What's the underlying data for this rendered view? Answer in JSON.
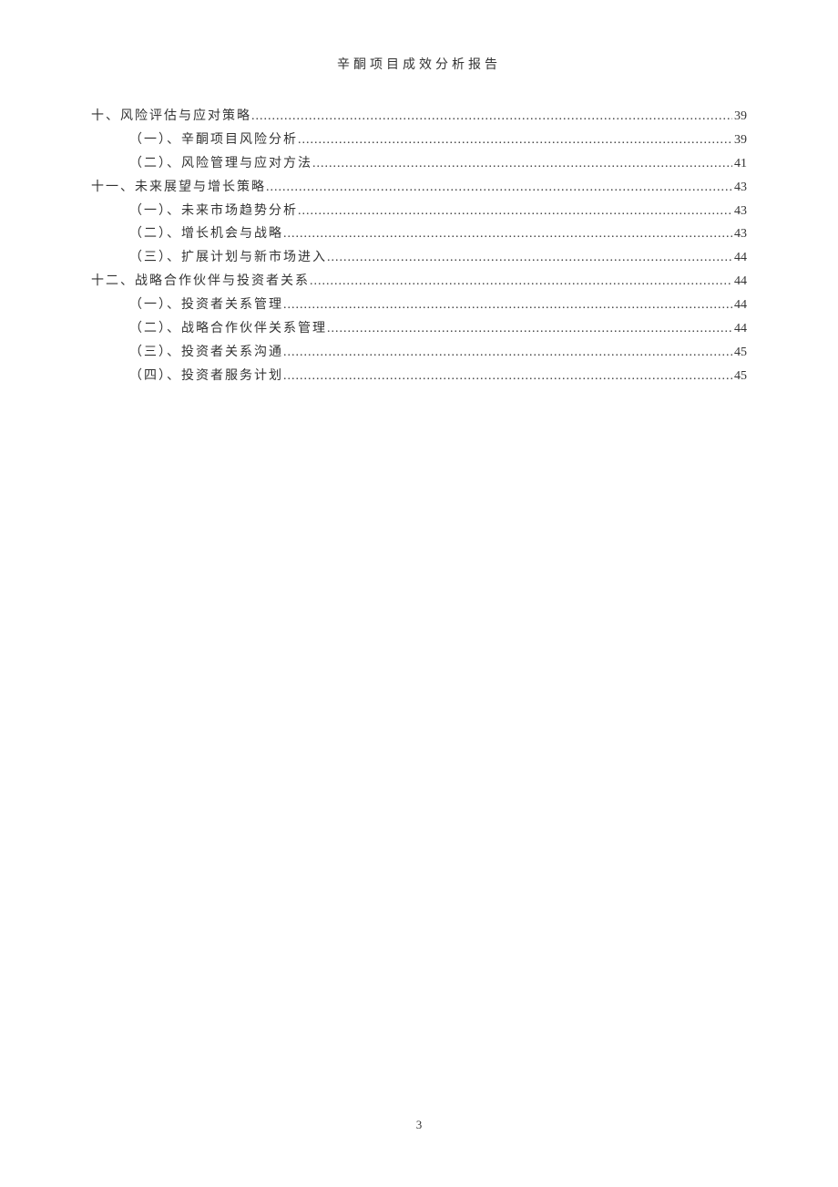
{
  "header": "辛酮项目成效分析报告",
  "pageNumber": "3",
  "toc": [
    {
      "label": "十、风险评估与应对策略",
      "page": "39",
      "level": 1
    },
    {
      "label": "（一）、辛酮项目风险分析",
      "page": "39",
      "level": 2
    },
    {
      "label": "（二）、风险管理与应对方法",
      "page": "41",
      "level": 2
    },
    {
      "label": "十一、未来展望与增长策略",
      "page": "43",
      "level": 1
    },
    {
      "label": "（一）、未来市场趋势分析",
      "page": "43",
      "level": 2
    },
    {
      "label": "（二）、增长机会与战略",
      "page": "43",
      "level": 2
    },
    {
      "label": "（三）、扩展计划与新市场进入",
      "page": "44",
      "level": 2
    },
    {
      "label": "十二、战略合作伙伴与投资者关系",
      "page": "44",
      "level": 1
    },
    {
      "label": "（一）、投资者关系管理",
      "page": "44",
      "level": 2
    },
    {
      "label": "（二）、战略合作伙伴关系管理",
      "page": "44",
      "level": 2
    },
    {
      "label": "（三）、投资者关系沟通",
      "page": "45",
      "level": 2
    },
    {
      "label": "（四）、投资者服务计划",
      "page": "45",
      "level": 2
    }
  ]
}
